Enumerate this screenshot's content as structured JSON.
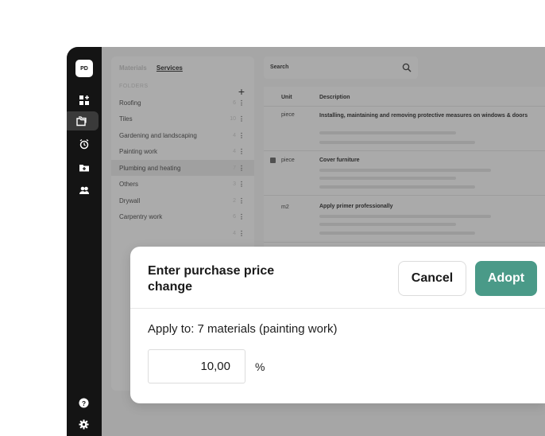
{
  "sidebar": {
    "avatar": "PD",
    "nav": [
      "dashboard-icon",
      "folders-icon",
      "alarm-icon",
      "folder-add-icon",
      "users-icon"
    ],
    "footer": [
      "help-icon",
      "settings-icon"
    ]
  },
  "folder_panel": {
    "tabs": [
      "Materials",
      "Services"
    ],
    "active_tab": "Services",
    "folders_title": "FOLDERS",
    "add_label": "+",
    "folders": [
      {
        "name": "Roofing",
        "count": "6"
      },
      {
        "name": "Tiles",
        "count": "10"
      },
      {
        "name": "Gardening and landscaping",
        "count": "4"
      },
      {
        "name": "Painting work",
        "count": "4"
      },
      {
        "name": "Plumbing and heating",
        "count": "7"
      },
      {
        "name": "Others",
        "count": "3"
      },
      {
        "name": "Drywall",
        "count": "2"
      },
      {
        "name": "Carpentry work",
        "count": "6"
      },
      {
        "name": "",
        "count": "4"
      }
    ]
  },
  "search": {
    "placeholder": "Search"
  },
  "table": {
    "headers": {
      "unit": "Unit",
      "description": "Description"
    },
    "rows": [
      {
        "unit": "piece",
        "description": "Installing, maintaining and removing protective measures on windows & doors",
        "checked": false
      },
      {
        "unit": "piece",
        "description": "Cover furniture",
        "checked": true
      },
      {
        "unit": "m2",
        "description": "Apply primer professionally",
        "checked": false
      }
    ]
  },
  "modal": {
    "title": "Enter purchase price change",
    "cancel_label": "Cancel",
    "adopt_label": "Adopt",
    "apply_text": "Apply to: 7 materials (painting work)",
    "value": "10,00",
    "unit": "%"
  },
  "colors": {
    "accent": "#4a9a88",
    "sidebar": "#141414"
  }
}
